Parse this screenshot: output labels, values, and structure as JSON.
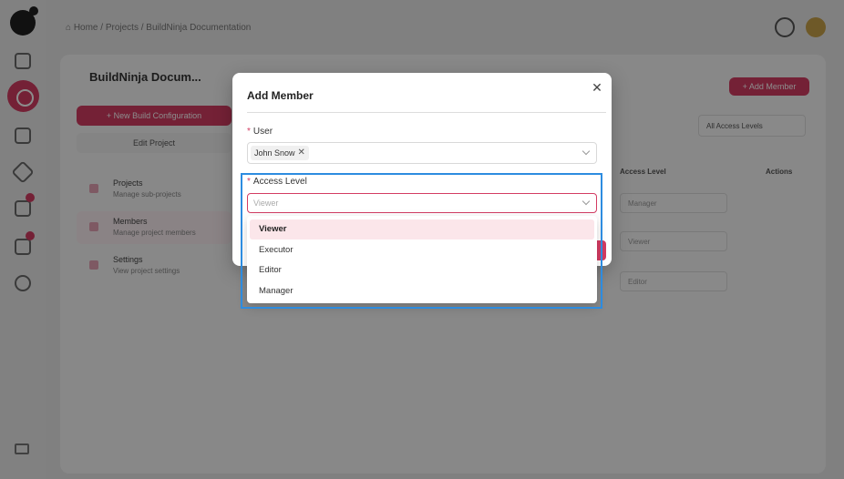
{
  "breadcrumb": "⌂ Home / Projects / BuildNinja Documentation",
  "app": {
    "project_title": "BuildNinja Docum...",
    "new_build_label": "+ New Build Configuration",
    "edit_project_label": "Edit Project",
    "add_member_label": "+ Add Member",
    "access_filter_label": "All Access Levels",
    "menu": [
      {
        "title": "Projects",
        "subtitle": "Manage sub-projects"
      },
      {
        "title": "Members",
        "subtitle": "Manage project members"
      },
      {
        "title": "Settings",
        "subtitle": "View project settings"
      }
    ],
    "table_headers": {
      "access": "Access Level",
      "actions": "Actions"
    },
    "row_values": [
      "Manager",
      "Viewer",
      "Editor"
    ]
  },
  "modal": {
    "title": "Add Member",
    "user_label": "User",
    "user_tag": "John Snow",
    "access_label": "Access Level",
    "access_placeholder": "Viewer",
    "options": [
      "Viewer",
      "Executor",
      "Editor",
      "Manager"
    ],
    "selected_option": "Viewer"
  },
  "colors": {
    "accent": "#d33c63",
    "highlight": "#2d8ce0",
    "selected_bg": "#fbe6ea"
  }
}
